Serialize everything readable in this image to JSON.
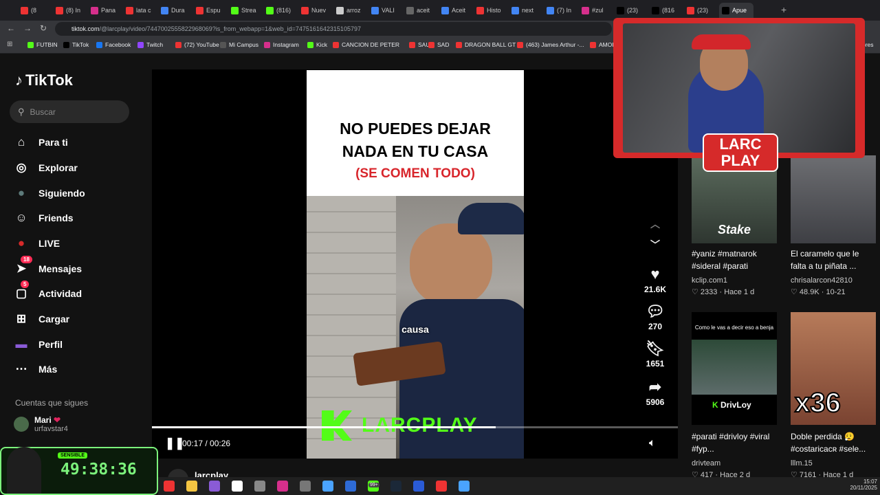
{
  "browser": {
    "tabs": [
      "(8",
      "(8) In",
      "Pana",
      "lata c",
      "Dura",
      "Espu",
      "Strea",
      "(816)",
      "Nuev",
      "arroz",
      "VALI",
      "aceit",
      "Aceit",
      "Histo",
      "next",
      "(7) In",
      "#zul",
      "(23)",
      "(816",
      "(23)",
      "Apue"
    ],
    "url_host": "tiktok.com",
    "url_path": "/@larcplay/video/7447002555822968069?is_from_webapp=1&web_id=7475161642315105797",
    "bookmarks": [
      "FUTBIN",
      "TikTok",
      "Facebook",
      "Twitch",
      "(72) YouTube",
      "Mi Campus",
      "Instagram",
      "Kick",
      "CANCION DE PETER",
      "SAU",
      "SAD",
      "DRAGON BALL GT",
      "(463) James Arthur -...",
      "AMOR"
    ],
    "bookmarks_right": "ores"
  },
  "sidebar": {
    "logo": "TikTok",
    "search_placeholder": "Buscar",
    "items": [
      {
        "label": "Para ti",
        "icon": "home-icon"
      },
      {
        "label": "Explorar",
        "icon": "compass-icon"
      },
      {
        "label": "Siguiendo",
        "icon": "following-avatar-icon"
      },
      {
        "label": "Friends",
        "icon": "friends-icon"
      },
      {
        "label": "LIVE",
        "icon": "live-icon"
      },
      {
        "label": "Mensajes",
        "icon": "messages-icon",
        "badge": "18"
      },
      {
        "label": "Actividad",
        "icon": "activity-icon",
        "badge": "5"
      },
      {
        "label": "Cargar",
        "icon": "upload-icon"
      },
      {
        "label": "Perfil",
        "icon": "profile-icon"
      },
      {
        "label": "Más",
        "icon": "more-icon"
      }
    ],
    "following_title": "Cuentas que sigues",
    "followed": {
      "name": "Mari",
      "handle": "urfavstar4"
    }
  },
  "video": {
    "headline_1": "NO PUEDES DEJAR",
    "headline_2": "NADA EN TU CASA",
    "headline_3": "(SE COMEN TODO)",
    "caption": "causa",
    "watermark": "LARCPLAY",
    "time": "00:17 / 00:26",
    "progress": 0.654,
    "author": "larcplay"
  },
  "actions": {
    "likes": "21.6K",
    "comments": "270",
    "saves": "1651",
    "shares": "5906"
  },
  "recommendations": [
    {
      "title": "#yaniz #matnarok #sideral #parati",
      "user": "kclip.com1",
      "likes": "2333",
      "age": "Hace 1 d",
      "overlay": "Stake"
    },
    {
      "title": "El caramelo que le falta a tu piñata ...",
      "user": "chrisalarcon42810",
      "likes": "48.9K",
      "age": "10-21"
    },
    {
      "title": "#parati #drivloy #viral #fyp...",
      "user": "drivteam",
      "likes": "417",
      "age": "Hace 2 d",
      "overlay": "DrivLoy",
      "top_text": "Como le vas a decir eso a benja"
    },
    {
      "title": "Doble perdida 😮‍💨 #costaricaᴄʀ #sele...",
      "user": "lllm.15",
      "likes": "7161",
      "age": "Hace 1 d",
      "overlay": "x36"
    }
  ],
  "overlay": {
    "brand": "LARC PLAY",
    "timer": "49:38:36",
    "label": "SENSIBLE"
  },
  "taskbar": {
    "time": "15:07",
    "date": "20/11/2025",
    "notif": "99+"
  }
}
